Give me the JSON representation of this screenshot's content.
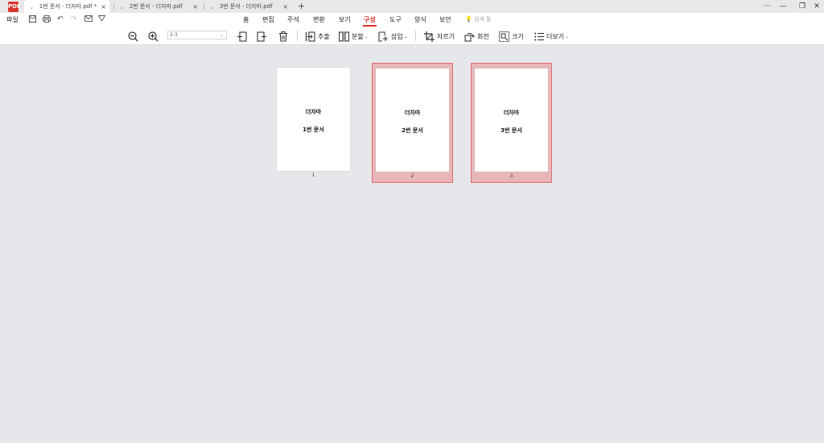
{
  "app": {
    "logo_text": "PDF"
  },
  "tabs": [
    {
      "label": "1번 문서 - 더자마.pdf *",
      "close": "×",
      "active": true
    },
    {
      "label": "2번 문서 - 더자마.pdf",
      "close": "×",
      "active": false
    },
    {
      "label": "3번 문서 - 더자마.pdf",
      "close": "×",
      "active": false
    }
  ],
  "tab_add": "+",
  "window_controls": {
    "more": "···",
    "minimize": "—",
    "restore": "❐",
    "close": "✕"
  },
  "menu": {
    "file": "파일",
    "items": [
      "홈",
      "편집",
      "주석",
      "변환",
      "보기",
      "구성",
      "도구",
      "양식",
      "보안"
    ],
    "active_index": 5,
    "search_hint": "검색 툴"
  },
  "ribbon": {
    "page_range": "2-3",
    "extract": "추출",
    "split": "분할",
    "insert": "삽입",
    "crop": "자르기",
    "rotate": "회전",
    "size": "크기",
    "more": "더보기"
  },
  "pages": [
    {
      "title": "더자마",
      "subtitle": "1번 문서",
      "number": "1",
      "selected": false
    },
    {
      "title": "더자마",
      "subtitle": "2번 문서",
      "number": "2",
      "selected": true
    },
    {
      "title": "더자마",
      "subtitle": "3번 문서",
      "number": "3",
      "selected": true
    }
  ],
  "colors": {
    "accent": "#d9342b",
    "selection_fill": "#e8b6b8",
    "selection_border": "#e06b6f",
    "workspace": "#e6e7eb"
  }
}
